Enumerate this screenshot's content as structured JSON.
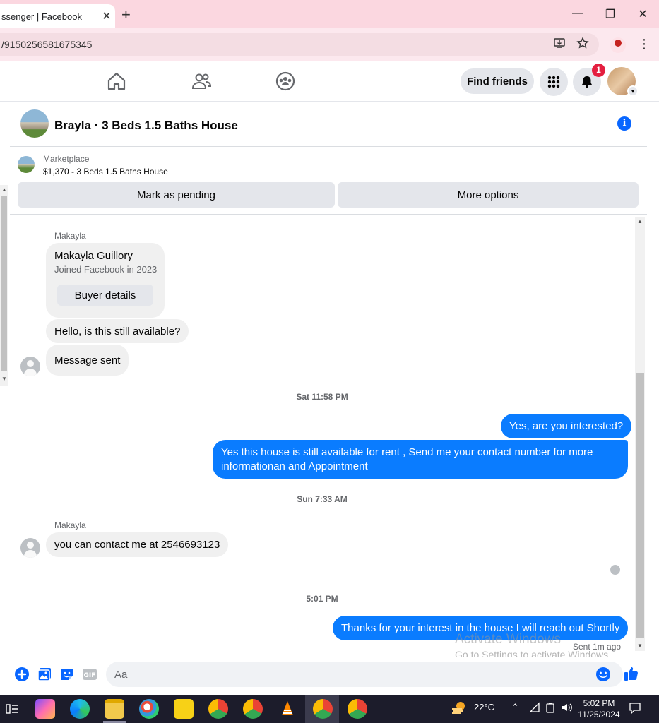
{
  "browser": {
    "tab_title": "ssenger | Facebook",
    "url": "/9150256581675345",
    "new_tab_symbol": "+",
    "tab_close_symbol": "✕",
    "minimize_symbol": "—",
    "restore_symbol": "❐",
    "close_symbol": "✕"
  },
  "nav": {
    "find_friends_label": "Find friends",
    "notification_count": "1"
  },
  "conversation": {
    "title": "Brayla · 3 Beds 1.5 Baths House",
    "info_symbol": "i"
  },
  "marketplace": {
    "label": "Marketplace",
    "listing": "$1,370 - 3 Beds 1.5 Baths House",
    "mark_pending_label": "Mark as pending",
    "more_options_label": "More options"
  },
  "messages": {
    "sender_name_1": "Makayla",
    "buyer_name": "Makayla Guillory",
    "buyer_joined": "Joined Facebook in 2023",
    "buyer_details_label": "Buyer details",
    "msg_1": "Hello, is this still available?",
    "msg_2": "Message sent",
    "stamp_1": "Sat 11:58 PM",
    "msg_3": "Yes, are you interested?",
    "msg_4": "Yes this house is still available for rent , Send me your contact number for more informationan and Appointment",
    "stamp_2": "Sun 7:33 AM",
    "sender_name_2": "Makayla",
    "msg_5": "you can contact me at 2546693123",
    "stamp_3": "5:01 PM",
    "msg_6": "Thanks for your interest in the house I will reach out Shortly",
    "sent_status": "Sent 1m ago"
  },
  "watermark": {
    "line1": "Activate Windows",
    "line2": "Go to Settings to activate Windows."
  },
  "composer": {
    "placeholder": "Aa"
  },
  "taskbar": {
    "temperature": "22°C",
    "time": "5:02 PM",
    "date": "11/25/2024"
  },
  "colors": {
    "messenger_blue": "#0a7cff",
    "facebook_blue": "#0866ff",
    "notification_red": "#e41e3f",
    "tab_strip_pink": "#fbd7e0"
  },
  "icons": [
    "home-icon",
    "friends-icon",
    "groups-icon",
    "menu-grid-icon",
    "bell-icon",
    "info-icon",
    "plus-icon",
    "photo-icon",
    "sticker-icon",
    "gif-icon",
    "emoji-icon",
    "like-icon",
    "download-icon",
    "star-icon",
    "profile-icon"
  ]
}
